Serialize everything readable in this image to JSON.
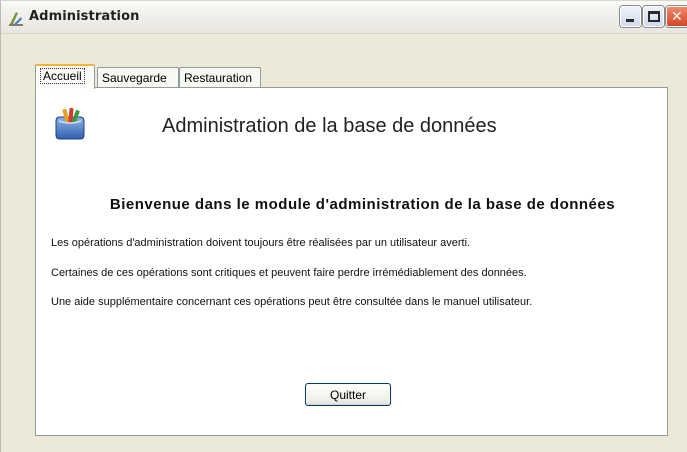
{
  "window": {
    "title": "Administration",
    "icon": "application-icon",
    "controls": [
      "minimize-icon",
      "maximize-icon",
      "close-icon"
    ]
  },
  "tabs": [
    {
      "label": "Accueil",
      "selected": true
    },
    {
      "label": "Sauvegarde",
      "selected": false
    },
    {
      "label": "Restauration",
      "selected": false
    }
  ],
  "panel": {
    "icon": "database-icon",
    "heading": "Administration de la base de données",
    "welcome": "Bienvenue dans le module d'administration de la base de données",
    "lines": [
      "Les opérations d'administration doivent toujours être réalisées par un utilisateur averti.",
      "Certaines de ces opérations sont critiques et peuvent faire perdre irrémédiablement des données.",
      "Une aide supplémentaire concernant ces opérations peut être consultée dans le manuel utilisateur."
    ],
    "quit_label": "Quitter"
  },
  "colors": {
    "window_bg": "#ece9d8",
    "tab_active_accent": "#f3b534",
    "button_border": "#003c74",
    "close_button": "#d6452a"
  }
}
